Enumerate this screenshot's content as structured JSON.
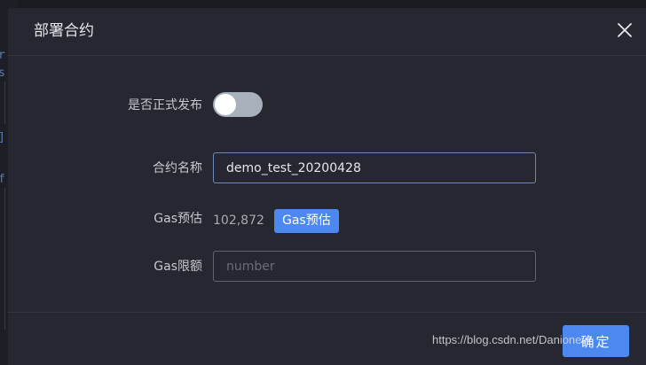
{
  "dialog": {
    "title": "部署合约",
    "close_icon": "close-icon"
  },
  "form": {
    "official_release": {
      "label": "是否正式发布",
      "enabled": false
    },
    "contract_name": {
      "label": "合约名称",
      "value": "demo_test_20200428"
    },
    "gas_estimate": {
      "label": "Gas预估",
      "value": "102,872",
      "button_label": "Gas预估"
    },
    "gas_limit": {
      "label": "Gas限额",
      "placeholder": "number",
      "value": ""
    }
  },
  "footer": {
    "confirm_label": "确定"
  },
  "watermark": "https://blog.csdn.net/Danionew",
  "colors": {
    "primary": "#4b89f0",
    "dialog_bg": "#262730",
    "toggle_off": "#a8b0bb"
  }
}
